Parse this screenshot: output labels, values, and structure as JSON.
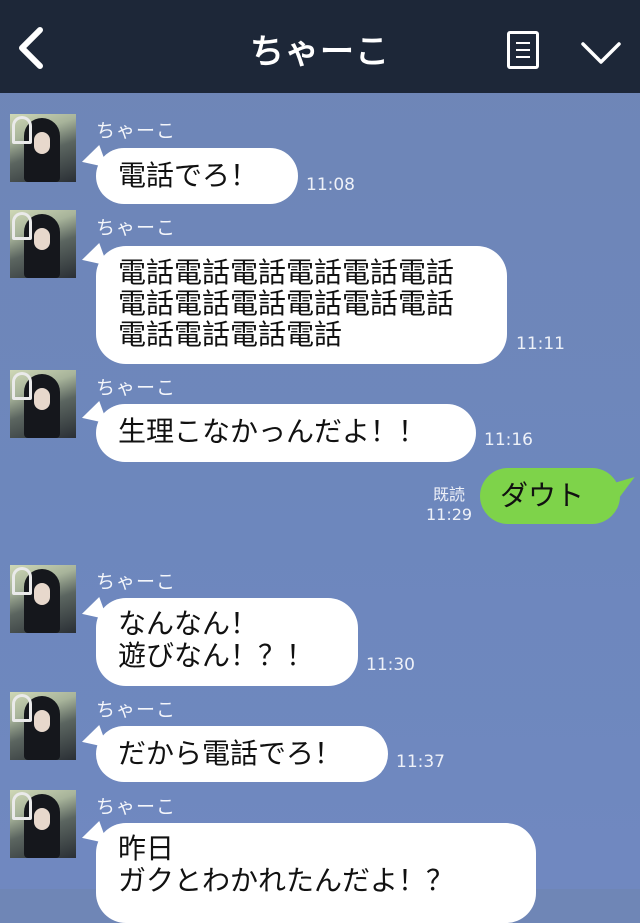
{
  "header": {
    "title": "ちゃーこ",
    "back_icon": "chevron-left-icon",
    "menu_icon": "menu-icon",
    "collapse_icon": "chevron-down-icon",
    "background": "#1d2738"
  },
  "colors": {
    "chat_background": "#6f86b6",
    "incoming_bubble": "#ffffff",
    "outgoing_bubble": "#7ed34a"
  },
  "messages": [
    {
      "sender": "ちゃーこ",
      "text": "電話でろ！",
      "time": "11:08"
    },
    {
      "sender": "ちゃーこ",
      "text": "電話電話電話電話電話電話\n電話電話電話電話電話電話\n電話電話電話電話",
      "time": "11:11"
    },
    {
      "sender": "ちゃーこ",
      "text": "生理こなかっんだよ！！",
      "time": "11:16"
    },
    {
      "sender": "me",
      "text": "ダウト",
      "read": "既読",
      "time": "11:29"
    },
    {
      "sender": "ちゃーこ",
      "text": "なんなん！\n遊びなん！？！",
      "time": "11:30"
    },
    {
      "sender": "ちゃーこ",
      "text": "だから電話でろ！",
      "time": "11:37"
    },
    {
      "sender": "ちゃーこ",
      "text": "昨日\nガクとわかれたんだよ！？"
    }
  ]
}
